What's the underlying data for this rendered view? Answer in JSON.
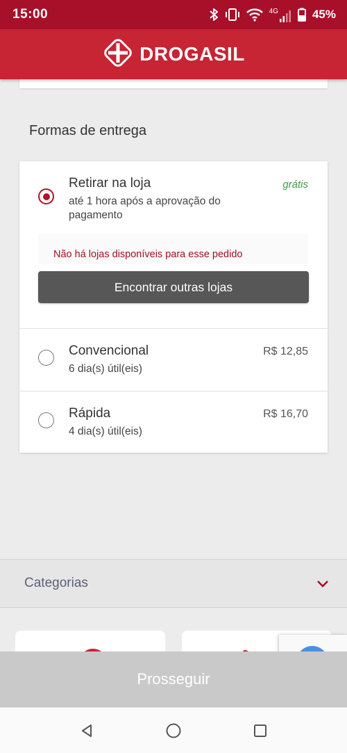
{
  "status_bar": {
    "time": "15:00",
    "network": "4G",
    "battery": "45%",
    "icons": [
      "bluetooth-icon",
      "vibrate-icon",
      "wifi-icon",
      "signal-icon",
      "battery-icon"
    ]
  },
  "header": {
    "brand": "DROGASIL",
    "logo_icon": "plus-diamond-icon"
  },
  "delivery": {
    "title": "Formas de entrega",
    "options": [
      {
        "title": "Retirar na loja",
        "subtitle_line1": "até 1 hora após a aprovação do",
        "subtitle_line2": "pagamento",
        "price": "grátis",
        "selected": true,
        "notice": "Não há lojas disponíveis para esse pedido",
        "button_label": "Encontrar outras lojas"
      },
      {
        "title": "Convencional",
        "subtitle": "6 dia(s) útil(eis)",
        "price": "R$ 12,85",
        "selected": false
      },
      {
        "title": "Rápida",
        "subtitle": "4 dia(s) útil(eis)",
        "price": "R$ 16,70",
        "selected": false
      }
    ]
  },
  "categories": {
    "label": "Categorias",
    "icon": "chevron-down-icon"
  },
  "proceed": {
    "label": "Prosseguir"
  },
  "colors": {
    "brand_red": "#c72434",
    "status_red": "#a8102a",
    "accent": "#b11226",
    "free_green": "#3e9a3e",
    "button_gray": "#575757",
    "disabled_gray": "#c9c9c9"
  }
}
